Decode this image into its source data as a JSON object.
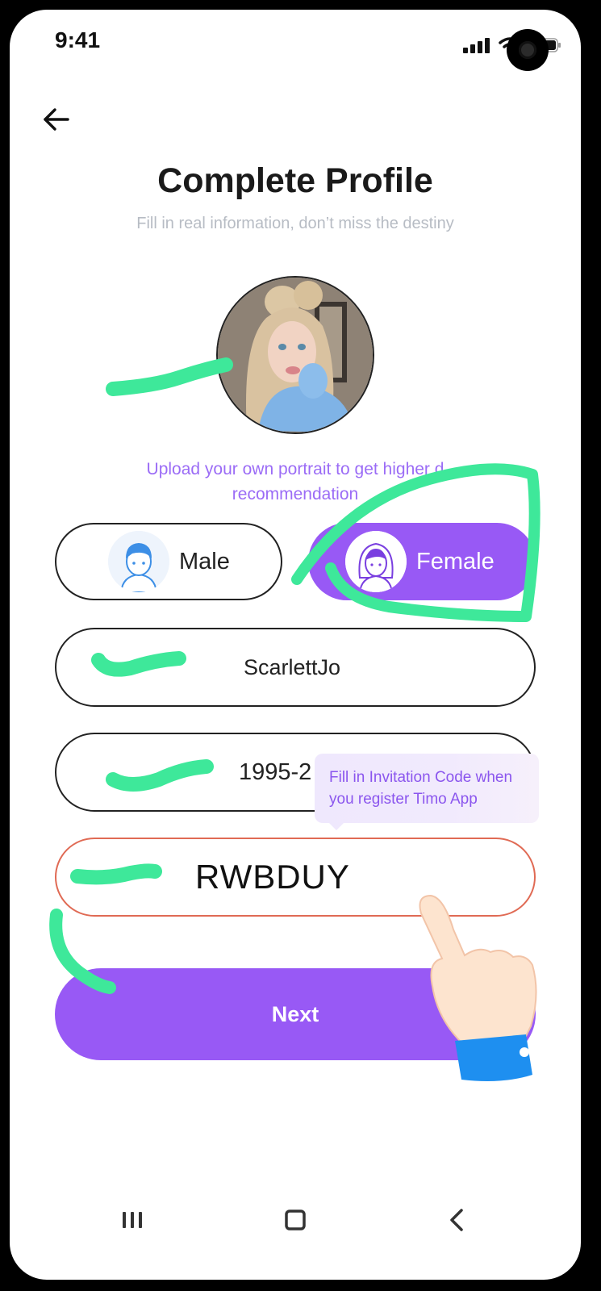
{
  "status_bar": {
    "time": "9:41",
    "icons": [
      "signal-icon",
      "wifi-icon",
      "battery-icon"
    ]
  },
  "header": {
    "back_icon": "arrow-left-icon",
    "title": "Complete Profile",
    "subtitle": "Fill in real information, don’t miss the destiny"
  },
  "profile": {
    "upload_hint_line1": "Upload your own portrait to get higher d",
    "upload_hint_line2": "recommendation"
  },
  "gender": {
    "male_label": "Male",
    "female_label": "Female",
    "selected": "Female"
  },
  "form": {
    "nickname_value": "ScarlettJo",
    "birthday_value": "1995-2",
    "invite_code_value": "RWBDUY",
    "invite_tooltip_line1": "Fill in Invitation Code when",
    "invite_tooltip_line2": "you register Timo App"
  },
  "actions": {
    "next_label": "Next"
  },
  "colors": {
    "accent": "#9859f5",
    "highlight_marker": "#3ee89a",
    "invite_border": "#e06a54"
  },
  "nav_bar": {
    "icons": [
      "recent-apps-icon",
      "home-icon",
      "back-chevron-icon"
    ]
  }
}
